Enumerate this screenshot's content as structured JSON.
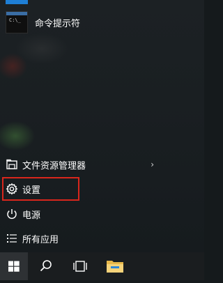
{
  "start_menu": {
    "apps": [
      {
        "label": "命令提示符",
        "icon": "command-prompt-icon"
      }
    ],
    "items": [
      {
        "label": "文件资源管理器",
        "icon": "file-explorer-icon",
        "has_submenu": true,
        "chevron": "›"
      },
      {
        "label": "设置",
        "icon": "gear-icon",
        "highlighted": true
      },
      {
        "label": "电源",
        "icon": "power-icon"
      },
      {
        "label": "所有应用",
        "icon": "list-icon"
      }
    ]
  },
  "taskbar": {
    "buttons": [
      {
        "name": "start",
        "icon": "windows-logo-icon"
      },
      {
        "name": "search",
        "icon": "search-icon"
      },
      {
        "name": "task-view",
        "icon": "task-view-icon"
      },
      {
        "name": "file-explorer",
        "icon": "folder-icon"
      }
    ]
  },
  "colors": {
    "accent": "#1e7fd6",
    "highlight_border": "#d9261c",
    "taskbar": "#1a1d1f"
  }
}
